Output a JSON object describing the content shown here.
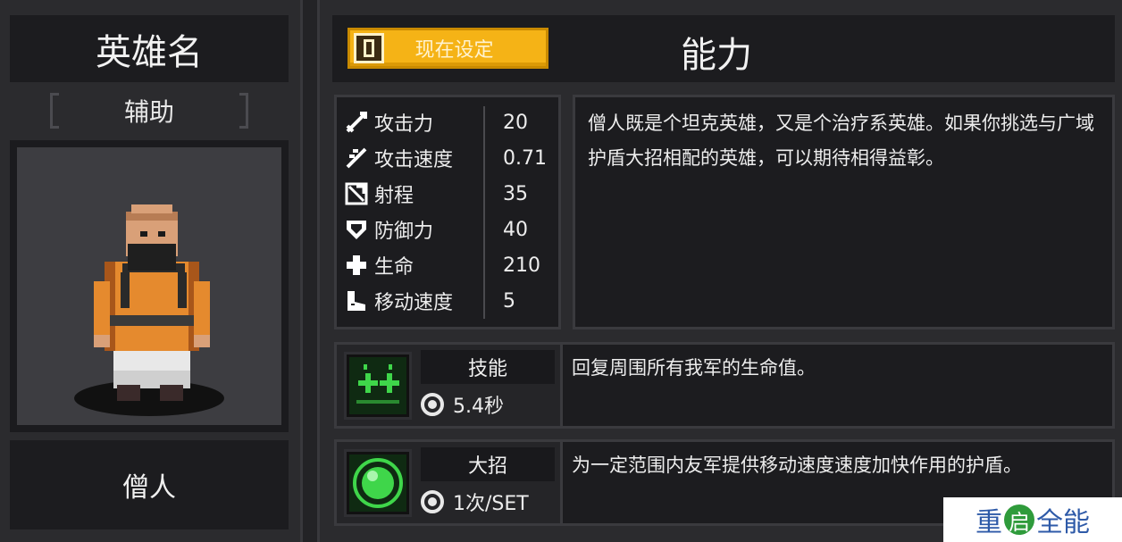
{
  "hero_panel": {
    "title": "英雄名",
    "role": "辅助",
    "name": "僧人"
  },
  "header": {
    "set_button_label": "现在设定",
    "section_title": "能力"
  },
  "stats": [
    {
      "icon": "sword-icon",
      "label": "攻击力",
      "value": "20"
    },
    {
      "icon": "fast-sword-icon",
      "label": "攻击速度",
      "value": "0.71"
    },
    {
      "icon": "range-icon",
      "label": "射程",
      "value": "35"
    },
    {
      "icon": "shield-icon",
      "label": "防御力",
      "value": "40"
    },
    {
      "icon": "health-cross-icon",
      "label": "生命",
      "value": "210"
    },
    {
      "icon": "boot-icon",
      "label": "移动速度",
      "value": "5"
    }
  ],
  "description": "僧人既是个坦克英雄，又是个治疗系英雄。如果你挑选与广域护盾大招相配的英雄，可以期待相得益彰。",
  "skill": {
    "name": "技能",
    "meta": "5.4秒",
    "icon": "heal-plus-icon",
    "description": "回复周围所有我军的生命值。"
  },
  "ultimate": {
    "name": "大招",
    "meta": "1次/SET",
    "icon": "green-orb-icon",
    "description": "为一定范围内友军提供移动速度速度加快作用的护盾。"
  },
  "watermark": {
    "text_before": "重",
    "circle_char": "启",
    "text_after": "全能"
  },
  "colors": {
    "button_yellow": "#f5b316",
    "panel_dark": "#1c1c1f",
    "skill_green": "#3fd64a"
  }
}
